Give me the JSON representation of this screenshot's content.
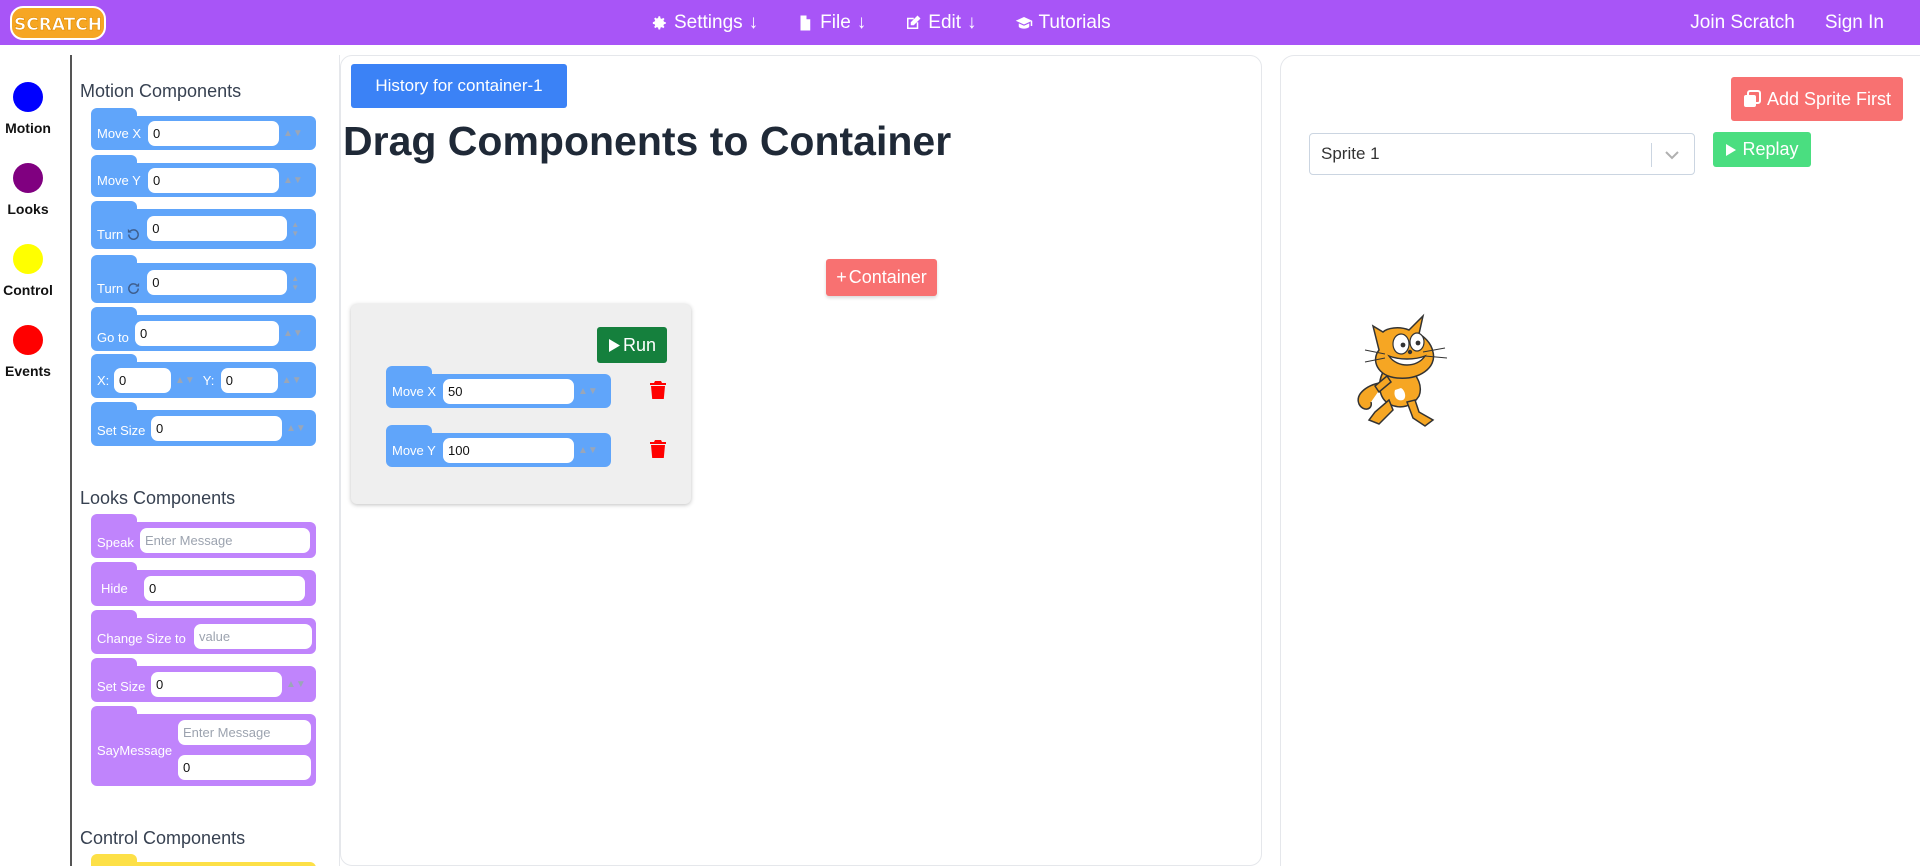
{
  "header": {
    "logo_text": "SCRATCH",
    "nav": [
      {
        "label": "Settings",
        "icon": "gear-icon"
      },
      {
        "label": "File",
        "icon": "file-icon"
      },
      {
        "label": "Edit",
        "icon": "edit-icon"
      },
      {
        "label": "Tutorials",
        "icon": "graduation-cap-icon"
      }
    ],
    "join_label": "Join Scratch",
    "signin_label": "Sign In",
    "colors": {
      "bar": "#a855f7"
    }
  },
  "categories": [
    {
      "label": "Motion",
      "color": "#0000ff"
    },
    {
      "label": "Looks",
      "color": "#800080"
    },
    {
      "label": "Control",
      "color": "#ffff00"
    },
    {
      "label": "Events",
      "color": "#ff0000"
    }
  ],
  "palette": {
    "motion_heading": "Motion Components",
    "motion": {
      "move_x_label": "Move X",
      "move_x_value": "0",
      "move_y_label": "Move Y",
      "move_y_value": "0",
      "turn_ccw_label": "Turn",
      "turn_ccw_value": "0",
      "turn_cw_label": "Turn",
      "turn_cw_value": "0",
      "goto_label": "Go to",
      "goto_value": "0",
      "x_label": "X:",
      "x_value": "0",
      "y_label": "Y:",
      "y_value": "0",
      "set_size_label": "Set Size",
      "set_size_value": "0"
    },
    "looks_heading": "Looks Components",
    "looks": {
      "speak_label": "Speak",
      "speak_placeholder": "Enter Message",
      "hide_label": "Hide",
      "hide_value": "0",
      "change_size_label": "Change Size to",
      "change_size_placeholder": "value",
      "set_size_label": "Set Size",
      "set_size_value": "0",
      "say_label": "SayMessage",
      "say_placeholder": "Enter Message",
      "say_value": "0"
    },
    "control_heading": "Control Components"
  },
  "editor": {
    "history_label": "History for container-1",
    "title": "Drag Components to Container",
    "add_container_label": "Container",
    "run_label": "Run",
    "blocks": [
      {
        "label": "Move X",
        "value": "50"
      },
      {
        "label": "Move Y",
        "value": "100"
      }
    ]
  },
  "stage": {
    "add_sprite_label": "Add Sprite First",
    "sprite_selected": "Sprite 1",
    "replay_label": "Replay"
  }
}
